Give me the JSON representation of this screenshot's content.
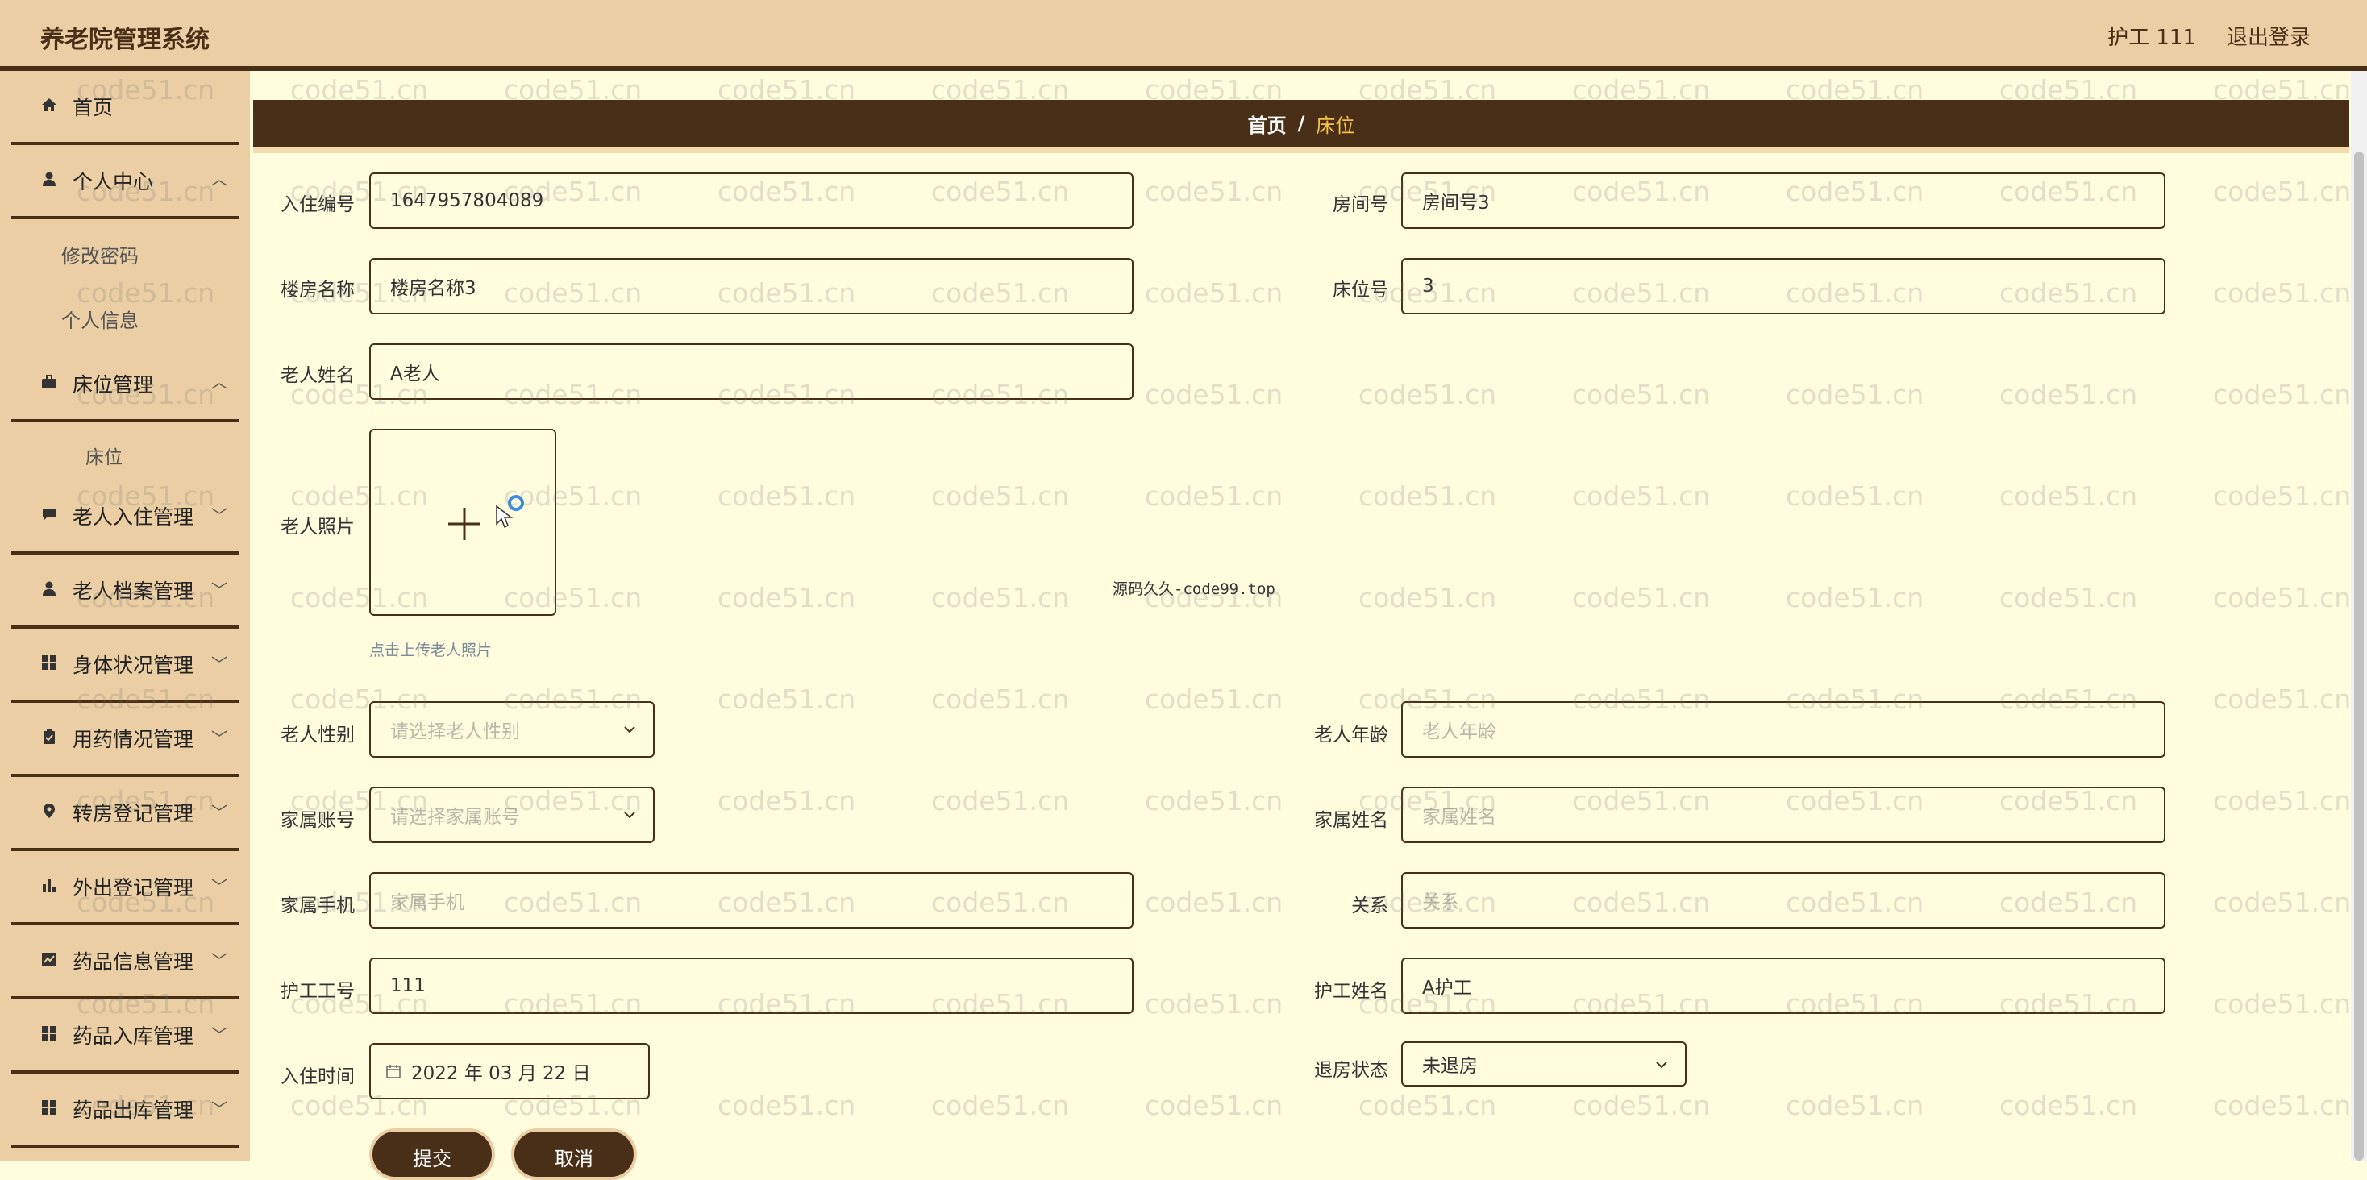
{
  "header": {
    "title": "养老院管理系统",
    "user": "护工 111",
    "logout": "退出登录"
  },
  "sidebar": {
    "home": "首页",
    "personal_center": "个人中心",
    "change_password": "修改密码",
    "personal_info": "个人信息",
    "bed_management": "床位管理",
    "bed": "床位",
    "checkin_management": "老人入住管理",
    "archive_management": "老人档案管理",
    "health_management": "身体状况管理",
    "medication_management": "用药情况管理",
    "room_transfer": "转房登记管理",
    "outing_registration": "外出登记管理",
    "drug_info": "药品信息管理",
    "drug_inbound": "药品入库管理",
    "drug_outbound": "药品出库管理"
  },
  "breadcrumb": {
    "home": "首页",
    "separator": "/",
    "current": "床位"
  },
  "form": {
    "checkin_no": {
      "label": "入住编号",
      "value": "1647957804089"
    },
    "room_no": {
      "label": "房间号",
      "value": "房间号3"
    },
    "building_name": {
      "label": "楼房名称",
      "value": "楼房名称3"
    },
    "bed_no": {
      "label": "床位号",
      "value": "3"
    },
    "elder_name": {
      "label": "老人姓名",
      "value": "A老人"
    },
    "elder_photo": {
      "label": "老人照片",
      "hint": "点击上传老人照片"
    },
    "elder_gender": {
      "label": "老人性别",
      "placeholder": "请选择老人性别"
    },
    "elder_age": {
      "label": "老人年龄",
      "placeholder": "老人年龄"
    },
    "family_account": {
      "label": "家属账号",
      "placeholder": "请选择家属账号"
    },
    "family_name": {
      "label": "家属姓名",
      "placeholder": "家属姓名"
    },
    "family_phone": {
      "label": "家属手机",
      "placeholder": "家属手机"
    },
    "relation": {
      "label": "关系",
      "placeholder": "关系"
    },
    "caregiver_no": {
      "label": "护工工号",
      "value": "111"
    },
    "caregiver_name": {
      "label": "护工姓名",
      "value": "A护工"
    },
    "checkin_time": {
      "label": "入住时间",
      "value": "2022 年 03 月 22 日"
    },
    "checkout_status": {
      "label": "退房状态",
      "value": "未退房"
    }
  },
  "buttons": {
    "submit": "提交",
    "cancel": "取消"
  },
  "watermark": "code51.cn",
  "center_mark": "源码久久-code99.top",
  "colors": {
    "accent": "#4a2f18",
    "sidebar_bg": "#ebcea3",
    "content_bg": "#fffdde",
    "breadcrumb_current": "#f4c24a"
  }
}
